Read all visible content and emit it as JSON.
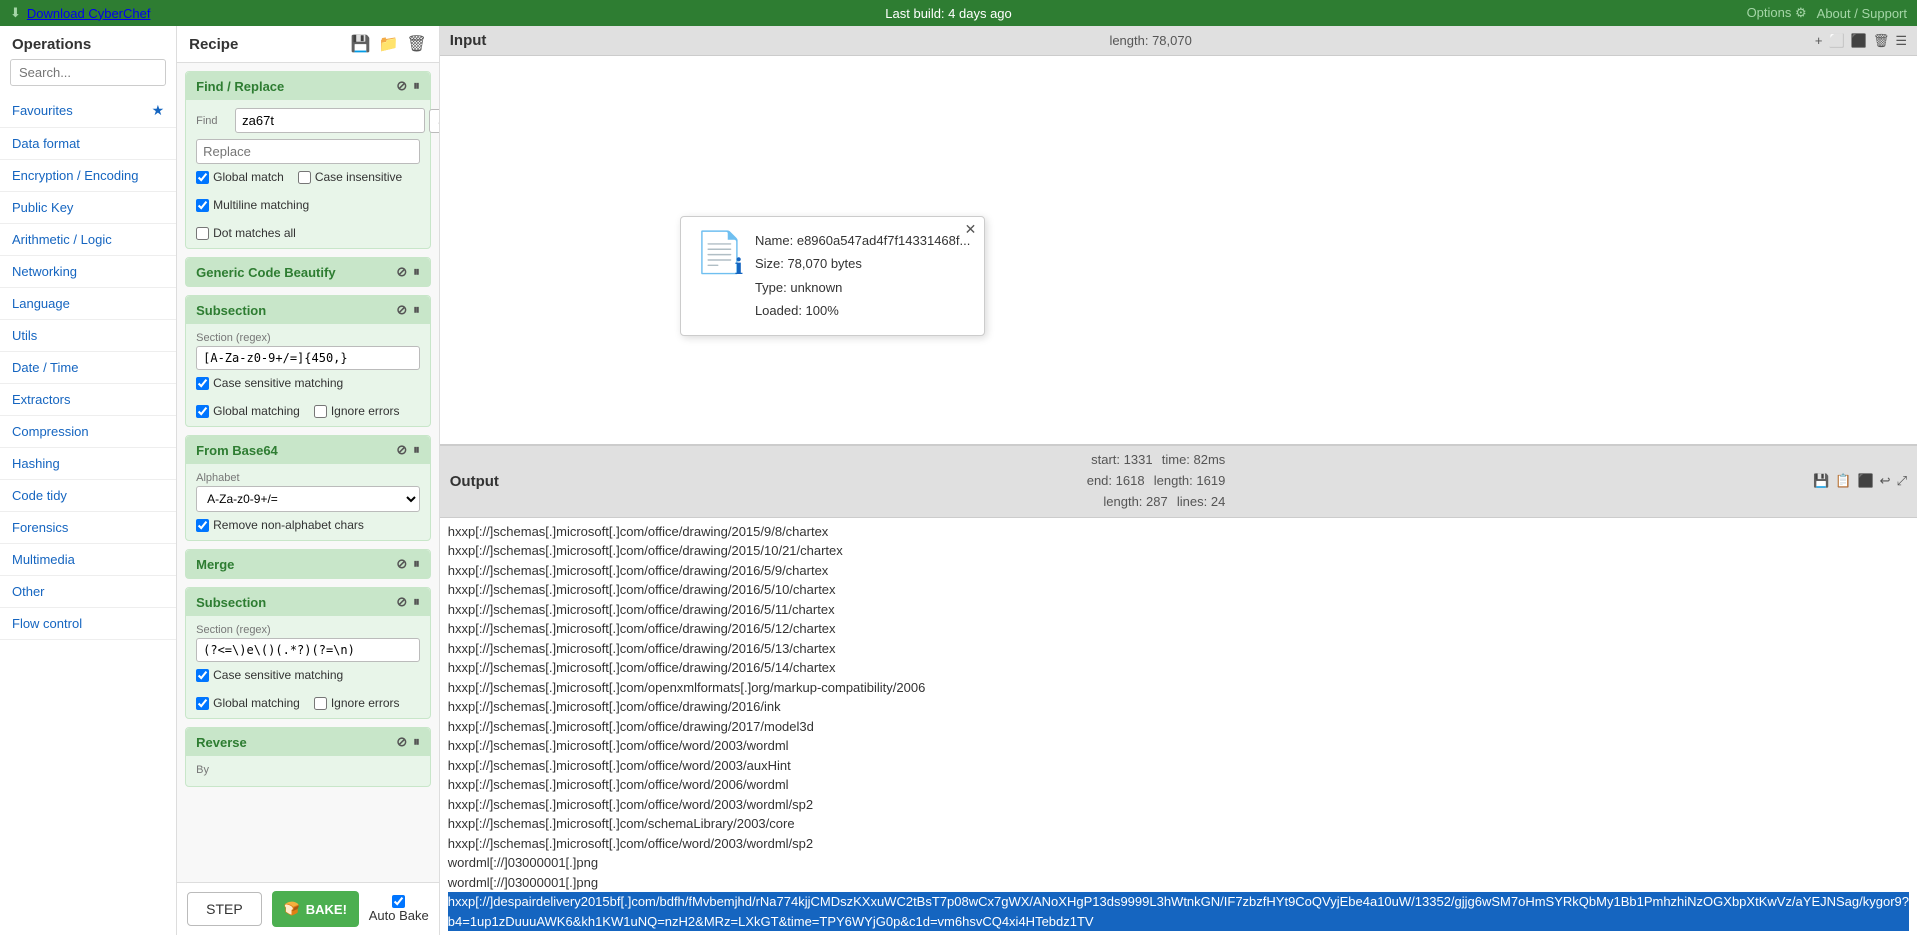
{
  "topbar": {
    "download": "Download CyberChef",
    "download_icon": "⬇",
    "last_build": "Last build: 4 days ago",
    "options": "Options",
    "options_icon": "⚙",
    "about": "About / Support"
  },
  "operations": {
    "title": "Operations",
    "search_placeholder": "Search...",
    "categories": [
      {
        "label": "Favourites",
        "has_star": true
      },
      {
        "label": "Data format",
        "has_star": false
      },
      {
        "label": "Encryption / Encoding",
        "has_star": false
      },
      {
        "label": "Public Key",
        "has_star": false
      },
      {
        "label": "Arithmetic / Logic",
        "has_star": false
      },
      {
        "label": "Networking",
        "has_star": false
      },
      {
        "label": "Language",
        "has_star": false
      },
      {
        "label": "Utils",
        "has_star": false
      },
      {
        "label": "Date / Time",
        "has_star": false
      },
      {
        "label": "Extractors",
        "has_star": false
      },
      {
        "label": "Compression",
        "has_star": false
      },
      {
        "label": "Hashing",
        "has_star": false
      },
      {
        "label": "Code tidy",
        "has_star": false
      },
      {
        "label": "Forensics",
        "has_star": false
      },
      {
        "label": "Multimedia",
        "has_star": false
      },
      {
        "label": "Other",
        "has_star": false
      },
      {
        "label": "Flow control",
        "has_star": false
      }
    ]
  },
  "recipe": {
    "title": "Recipe",
    "save_icon": "💾",
    "folder_icon": "📁",
    "trash_icon": "🗑",
    "operations": [
      {
        "id": "find-replace",
        "label": "Find / Replace",
        "find_label": "Find",
        "find_value": "za67t",
        "find_type": "SIMPLE STRING",
        "replace_label": "Replace",
        "replace_value": "",
        "global_match": true,
        "case_insensitive": false,
        "multiline_matching": true,
        "dot_matches_all": false,
        "checkboxes": [
          {
            "label": "Global match",
            "checked": true
          },
          {
            "label": "Case insensitive",
            "checked": false
          },
          {
            "label": "Multiline matching",
            "checked": true
          },
          {
            "label": "Dot matches all",
            "checked": false
          }
        ]
      },
      {
        "id": "generic-code-beautify",
        "label": "Generic Code Beautify"
      },
      {
        "id": "subsection-1",
        "label": "Subsection",
        "section_label": "Section (regex)",
        "section_value": "[A-Za-z0-9+/=]{450,}",
        "checkboxes": [
          {
            "label": "Case sensitive matching",
            "checked": true
          },
          {
            "label": "Global matching",
            "checked": true
          },
          {
            "label": "Ignore errors",
            "checked": false
          }
        ]
      },
      {
        "id": "from-base64",
        "label": "From Base64",
        "alphabet_label": "Alphabet",
        "alphabet_value": "A-Za-z0-9+/=",
        "remove_non_alphabet": true,
        "remove_label": "Remove non-alphabet chars"
      },
      {
        "id": "merge",
        "label": "Merge"
      },
      {
        "id": "subsection-2",
        "label": "Subsection",
        "section_label": "Section (regex)",
        "section_value": "(?<=\\)e\\()(.*?)(?=\\n)",
        "checkboxes": [
          {
            "label": "Case sensitive matching",
            "checked": true
          },
          {
            "label": "Global matching",
            "checked": true
          },
          {
            "label": "Ignore errors",
            "checked": false
          }
        ]
      },
      {
        "id": "reverse",
        "label": "Reverse",
        "by_label": "By"
      }
    ],
    "step_label": "STEP",
    "bake_icon": "🍞",
    "bake_label": "BAKE!",
    "auto_bake_label": "Auto Bake",
    "auto_bake_checked": true
  },
  "input": {
    "title": "Input",
    "length_label": "length: 78,070",
    "add_icon": "+",
    "file_info": {
      "name": "Name: e8960a547ad4f7f14331468f...",
      "size": "Size: 78,070 bytes",
      "type": "Type: unknown",
      "loaded": "Loaded: 100%"
    }
  },
  "output": {
    "title": "Output",
    "meta": {
      "start": "start: 1331",
      "time": "time: 82ms",
      "end": "end: 1618",
      "length": "length: 1619",
      "length2": "length: 287",
      "lines": "lines: 24"
    },
    "lines": [
      "hxxp[://]schemas[.]microsoft[.]com/office/drawing/2015/9/8/chartex",
      "hxxp[://]schemas[.]microsoft[.]com/office/drawing/2015/10/21/chartex",
      "hxxp[://]schemas[.]microsoft[.]com/office/drawing/2016/5/9/chartex",
      "hxxp[://]schemas[.]microsoft[.]com/office/drawing/2016/5/10/chartex",
      "hxxp[://]schemas[.]microsoft[.]com/office/drawing/2016/5/11/chartex",
      "hxxp[://]schemas[.]microsoft[.]com/office/drawing/2016/5/12/chartex",
      "hxxp[://]schemas[.]microsoft[.]com/office/drawing/2016/5/13/chartex",
      "hxxp[://]schemas[.]microsoft[.]com/office/drawing/2016/5/14/chartex",
      "hxxp[://]schemas[.]microsoft[.]com/openxmlformats[.]org/markup-compatibility/2006",
      "hxxp[://]schemas[.]microsoft[.]com/office/drawing/2016/ink",
      "hxxp[://]schemas[.]microsoft[.]com/office/drawing/2017/model3d",
      "hxxp[://]schemas[.]microsoft[.]com/office/word/2003/wordml",
      "hxxp[://]schemas[.]microsoft[.]com/office/word/2003/auxHint",
      "hxxp[://]schemas[.]microsoft[.]com/office/word/2006/wordml",
      "hxxp[://]schemas[.]microsoft[.]com/office/word/2003/wordml/sp2",
      "hxxp[://]schemas[.]microsoft[.]com/schemaLibrary/2003/core",
      "hxxp[://]schemas[.]microsoft[.]com/office/word/2003/wordml/sp2",
      "wordml[://]03000001[.]png",
      "wordml[://]03000001[.]png",
      "hxxp[://]despairdelivery2015bf[.]com/bdfh/fMvbemjhd/rNa774kjjCMDszKXxuWC2tBsT7p08wCx7gWX/ANoXHgP13ds9999L3hWtnkGN/IF7zbzfHYt9CoQVyjEbe4a10uW/13352/gjjg6wSM7oHmSYRkQbMy1Bb1PmhzhiNzOGXbpXtKwVz/aYEJNSag/kygor9?b4=1up1zDuuuAWK6&kh1KW1uNQ=nzH2&MRz=LXkGT&time=TPY6WYjG0p&c1d=vm6hsvCQ4xi4HTebdz1TV",
      ""
    ],
    "highlighted_line": "hxxp[://]despairdelivery2015bf[.]com/bdfh/fMvbemjhd/rNa774kjjCMDszKXxuWC2tBsT7p08wCx7gWX/ANoXHgP13ds9999L3hWtnkGN/IF7zbzfHYt9CoQVyjEbe4a10uW/13352/gjjg6wSM7oHmSYRkQbMy1Bb1PmhzhiNzOGXbpXtKwVz/aYEJNSag/kygor9?b4=1up1zDuuuAWK6&kh1KW1uNQ=nzH2&MRz=LXkGT&time=TPY6WYjG0p&c1d=vm6hsvCQ4xi4HTebdz1TV"
  }
}
